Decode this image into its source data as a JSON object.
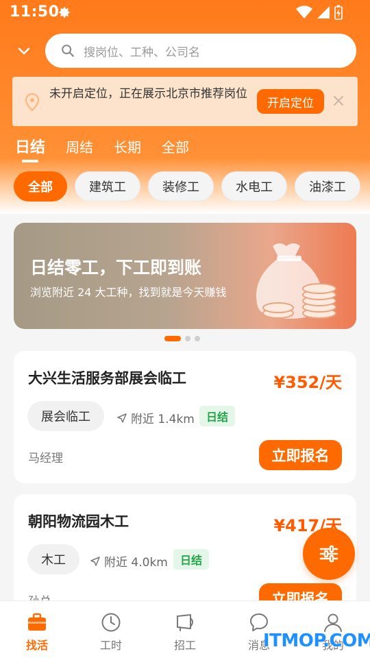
{
  "status_bar": {
    "time": "11:50"
  },
  "search": {
    "placeholder": "搜岗位、工种、公司名"
  },
  "location_banner": {
    "text": "未开启定位，正在展示北京市推荐岗位",
    "button": "开启定位"
  },
  "tabs": [
    {
      "label": "日结",
      "active": true
    },
    {
      "label": "周结",
      "active": false
    },
    {
      "label": "长期",
      "active": false
    },
    {
      "label": "全部",
      "active": false
    }
  ],
  "chips": [
    {
      "label": "全部",
      "active": true
    },
    {
      "label": "建筑工",
      "active": false
    },
    {
      "label": "装修工",
      "active": false
    },
    {
      "label": "水电工",
      "active": false
    },
    {
      "label": "油漆工",
      "active": false
    }
  ],
  "promo_banner": {
    "title": "日结零工，下工即到账",
    "subtitle": "浏览附近 24 大工种，找到就是今天赚钱",
    "slide_count": 3,
    "active_slide": 1
  },
  "jobs": [
    {
      "title": "大兴生活服务部展会临工",
      "price": "¥352/天",
      "tag": "展会临工",
      "distance": "附近 1.4km",
      "badge": "日结",
      "contact": "马经理",
      "apply": "立即报名"
    },
    {
      "title": "朝阳物流园木工",
      "price": "¥417/天",
      "tag": "木工",
      "distance": "附近 4.0km",
      "badge": "日结",
      "contact": "孙总",
      "apply": "立即报名"
    }
  ],
  "bottom_nav": [
    {
      "label": "找活",
      "icon": "briefcase-icon",
      "active": true
    },
    {
      "label": "工时",
      "icon": "clock-icon",
      "active": false
    },
    {
      "label": "招工",
      "icon": "megaphone-icon",
      "active": false
    },
    {
      "label": "消息",
      "icon": "chat-bubble-icon",
      "active": false
    },
    {
      "label": "我的",
      "icon": "person-icon",
      "active": false
    }
  ],
  "watermark": "ITMOP.COM",
  "colors": {
    "accent": "#ff6a00",
    "price": "#ff5a00",
    "badge_green": "#22a547"
  }
}
